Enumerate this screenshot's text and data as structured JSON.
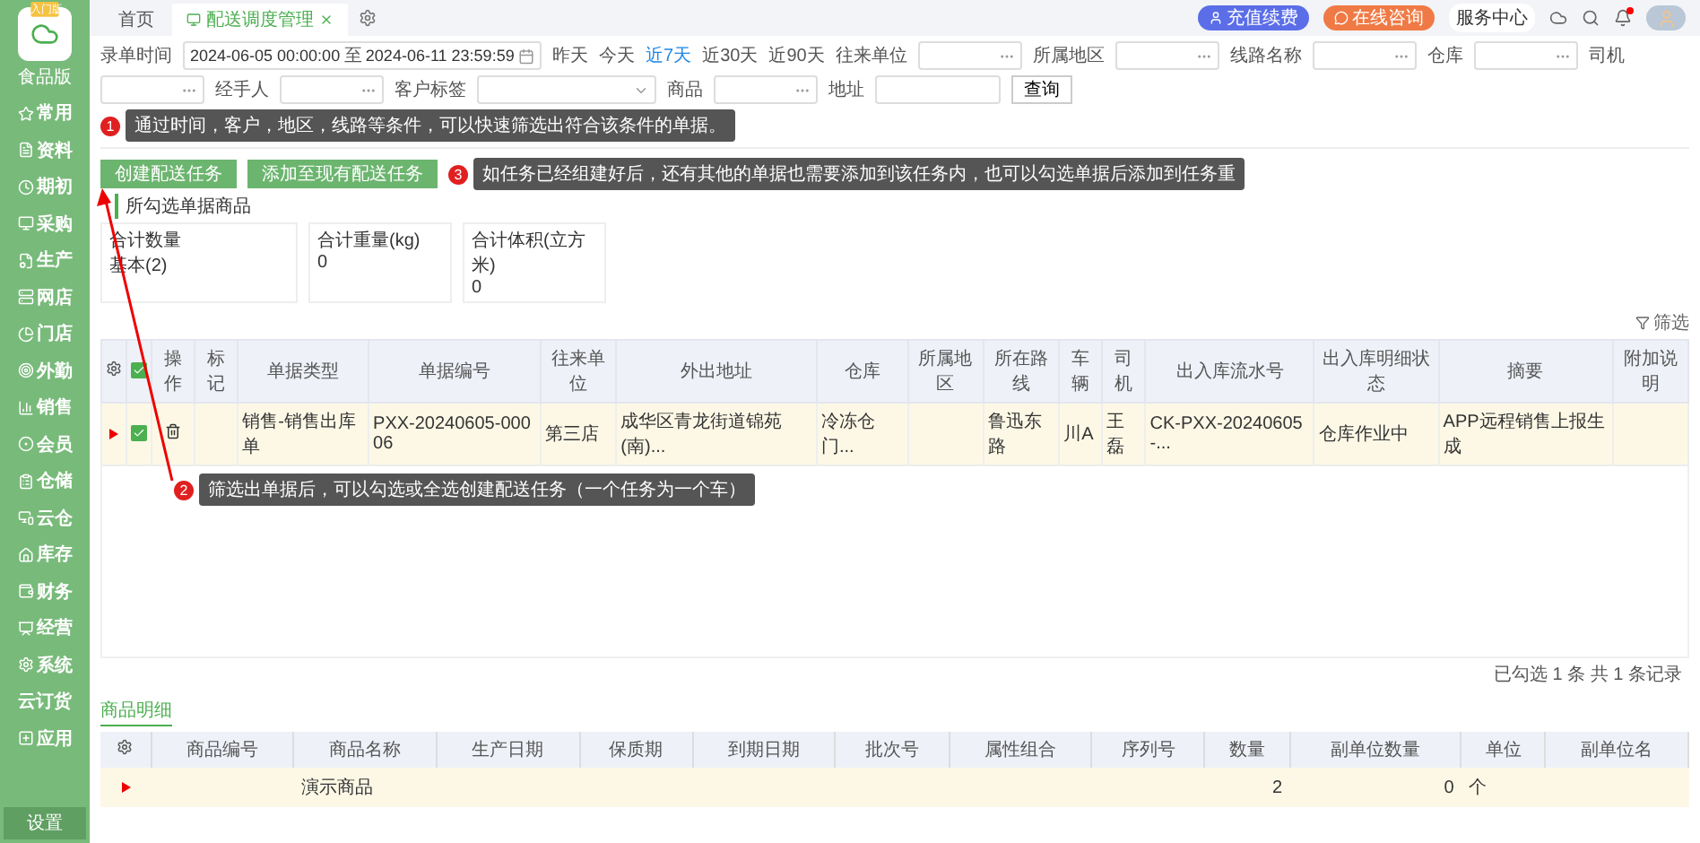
{
  "sidebar": {
    "logo_badge": "入门版",
    "logo_caption": "食品版",
    "items": [
      {
        "label": "常用"
      },
      {
        "label": "资料"
      },
      {
        "label": "期初"
      },
      {
        "label": "采购"
      },
      {
        "label": "生产"
      },
      {
        "label": "网店"
      },
      {
        "label": "门店"
      },
      {
        "label": "外勤"
      },
      {
        "label": "销售"
      },
      {
        "label": "会员"
      },
      {
        "label": "仓储"
      },
      {
        "label": "云仓"
      },
      {
        "label": "库存"
      },
      {
        "label": "财务"
      },
      {
        "label": "经营"
      },
      {
        "label": "系统"
      },
      {
        "label": "云订货"
      },
      {
        "label": "应用"
      }
    ],
    "settings": "设置"
  },
  "tabs": [
    {
      "label": "首页",
      "selected": false,
      "closable": false
    },
    {
      "label": "配送调度管理",
      "selected": true,
      "closable": true
    }
  ],
  "header": {
    "recharge": "充值续费",
    "consult": "在线咨询",
    "service": "服务中心",
    "notification": true
  },
  "filters": {
    "date": {
      "label": "录单时间",
      "start": "2024-06-05 00:00:00",
      "separator": "至",
      "end": "2024-06-11 23:59:59"
    },
    "quick": [
      {
        "label": "昨天",
        "selected": false
      },
      {
        "label": "今天",
        "selected": false
      },
      {
        "label": "近7天",
        "selected": true
      },
      {
        "label": "近30天",
        "selected": false
      },
      {
        "label": "近90天",
        "selected": false
      }
    ],
    "fields": [
      {
        "label": "往来单位",
        "kind": "picker"
      },
      {
        "label": "所属地区",
        "kind": "picker"
      },
      {
        "label": "线路名称",
        "kind": "picker"
      },
      {
        "label": "仓库",
        "kind": "picker"
      },
      {
        "label": "司机",
        "kind": "picker"
      },
      {
        "label": "经手人",
        "kind": "picker"
      },
      {
        "label": "客户标签",
        "kind": "select"
      },
      {
        "label": "商品",
        "kind": "picker"
      },
      {
        "label": "地址",
        "kind": "text"
      }
    ],
    "query": "查询"
  },
  "tips": [
    {
      "number": "1",
      "text": "通过时间，客户，地区，线路等条件，可以快速筛选出符合该条件的单据。"
    },
    {
      "number": "3",
      "text": "如任务已经组建好后，还有其他的单据也需要添加到该任务内，也可以勾选单据后添加到任务重"
    },
    {
      "number": "2",
      "text": "筛选出单据后，可以勾选或全选创建配送任务（一个任务为一个车）"
    }
  ],
  "actions": [
    "创建配送任务",
    "添加至现有配送任务"
  ],
  "selection_title": "所勾选单据商品",
  "summary": [
    {
      "label": "合计数量",
      "value": "基本(2)"
    },
    {
      "label": "合计重量(kg)",
      "value": "0"
    },
    {
      "label": "合计体积(立方米)",
      "value": "0"
    }
  ],
  "filter_link": "筛选",
  "table": {
    "all_checked": true,
    "columns": [
      {
        "label": "操作",
        "kind": "action"
      },
      {
        "label": "标记",
        "kind": "text"
      },
      {
        "label": "单据类型",
        "kind": "text"
      },
      {
        "label": "单据编号",
        "kind": "text"
      },
      {
        "label": "往来单位",
        "kind": "text"
      },
      {
        "label": "外出地址",
        "kind": "text"
      },
      {
        "label": "仓库",
        "kind": "text"
      },
      {
        "label": "所属地区",
        "kind": "text"
      },
      {
        "label": "所在路线",
        "kind": "text"
      },
      {
        "label": "车辆",
        "kind": "text"
      },
      {
        "label": "司机",
        "kind": "text"
      },
      {
        "label": "出入库流水号",
        "kind": "text"
      },
      {
        "label": "出入库明细状态",
        "kind": "text"
      },
      {
        "label": "摘要",
        "kind": "text"
      },
      {
        "label": "附加说明",
        "kind": "text"
      }
    ],
    "rows": [
      {
        "flagged": true,
        "checked": true,
        "cells": [
          null,
          null,
          "销售-销售出库单",
          "PXX-20240605-00006",
          "第三店",
          "成华区青龙街道锦苑(南)...",
          "冷冻仓门...",
          null,
          "鲁迅东路",
          "川A",
          "王磊",
          "CK-PXX-20240605-...",
          "仓库作业中",
          "APP远程销售上报生成",
          null
        ]
      }
    ]
  },
  "footer": "已勾选 1 条 共 1 条记录",
  "detail": {
    "tab": "商品明细",
    "columns": [
      "商品编号",
      "商品名称",
      "生产日期",
      "保质期",
      "到期日期",
      "批次号",
      "属性组合",
      "序列号",
      "数量",
      "副单位数量",
      "单位",
      "副单位名"
    ],
    "rows": [
      {
        "flagged": true,
        "cells": [
          null,
          "演示商品",
          null,
          null,
          null,
          null,
          null,
          null,
          "2",
          "0",
          "个",
          null
        ]
      }
    ]
  }
}
